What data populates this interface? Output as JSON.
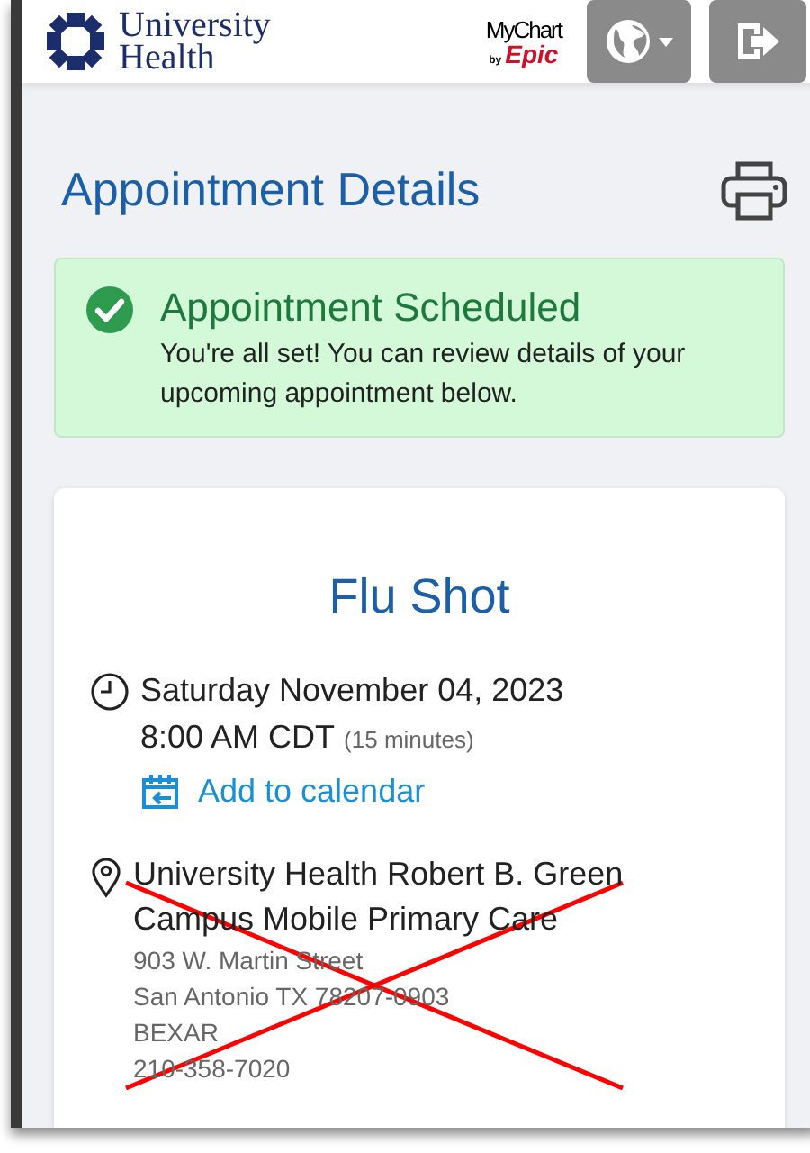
{
  "header": {
    "logo": {
      "line1": "University",
      "line2": "Health"
    },
    "partner_logo": {
      "name": "MyChart",
      "by": "by",
      "brand": "Epic"
    }
  },
  "page_title": "Appointment Details",
  "alert": {
    "kind": "success",
    "title": "Appointment Scheduled",
    "message": "You're all set! You can review details of your upcoming appointment below."
  },
  "appointment": {
    "title": "Flu Shot",
    "date": "Saturday November 04, 2023",
    "time": "8:00 AM CDT",
    "duration": "(15 minutes)",
    "calendar_link": "Add to calendar",
    "location": {
      "name": "University Health Robert B. Green Campus Mobile Primary Care",
      "address_lines": [
        "903 W. Martin Street",
        "San Antonio TX 78207-0903",
        "BEXAR",
        "210-358-7020"
      ],
      "crossed_out": true
    }
  }
}
